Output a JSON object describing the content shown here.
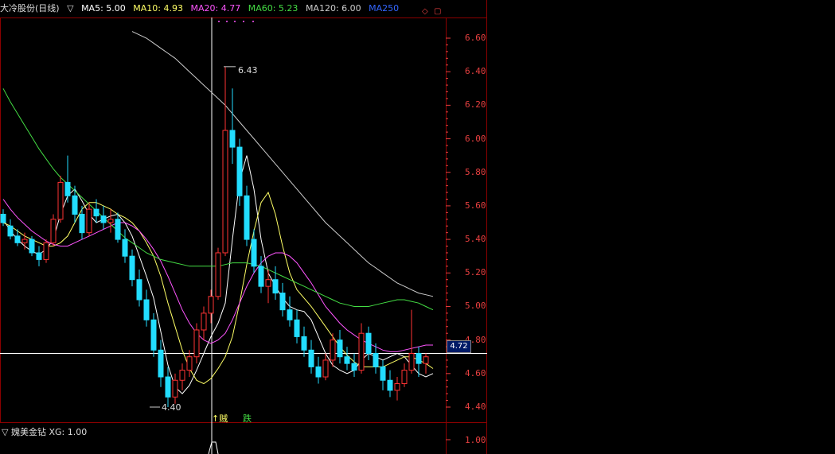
{
  "header": {
    "stock_title": "大冷股份(日线)",
    "arrow": "▽",
    "ma5": "MA5: 5.00",
    "ma10": "MA10: 4.93",
    "ma20": "MA20: 4.77",
    "ma60": "MA60: 5.23",
    "ma120": "MA120: 6.00",
    "ma250": "MA250"
  },
  "colors": {
    "ma5": "#ffffff",
    "ma10": "#ffff66",
    "ma20": "#ff55ff",
    "ma60": "#44dd44",
    "ma120": "#cccccc",
    "ma250": "#3366ff",
    "up": "#ff3333",
    "down": "#22ddff",
    "axis": "#e84040",
    "grid": "#550000"
  },
  "y_axis": [
    "6.60",
    "6.40",
    "6.20",
    "6.00",
    "5.80",
    "5.60",
    "5.40",
    "5.20",
    "5.00",
    "4.80",
    "4.60",
    "4.40"
  ],
  "price_tag": "4.72",
  "annotations": {
    "high": "6.43",
    "low": "4.40"
  },
  "bottom_marks": {
    "left": "↑贼",
    "right": "跌"
  },
  "sub_panel": {
    "title": "▽ 媿美金钻 XG: 1.00",
    "y_value": "1.00"
  },
  "chart_data": {
    "type": "candlestick",
    "ylim": [
      4.3,
      6.75
    ],
    "series": [
      {
        "name": "MA5",
        "values": [
          5.52,
          5.45,
          5.4,
          5.36,
          5.33,
          5.31,
          5.34,
          5.4,
          5.55,
          5.66,
          5.7,
          5.63,
          5.55,
          5.5,
          5.52,
          5.54,
          5.55,
          5.5,
          5.42,
          5.3,
          5.18,
          5.05,
          4.85,
          4.65,
          4.52,
          4.48,
          4.53,
          4.62,
          4.72,
          4.82,
          4.9,
          5.02,
          5.4,
          5.75,
          5.9,
          5.7,
          5.4,
          5.2,
          5.12,
          5.05,
          5.0,
          4.98,
          4.97,
          4.92,
          4.82,
          4.72,
          4.65,
          4.62,
          4.6,
          4.62,
          4.68,
          4.72,
          4.7,
          4.68,
          4.7,
          4.72,
          4.7,
          4.65,
          4.6,
          4.58,
          4.6
        ]
      },
      {
        "name": "MA10",
        "values": [
          5.5,
          5.48,
          5.45,
          5.42,
          5.4,
          5.38,
          5.36,
          5.36,
          5.38,
          5.42,
          5.5,
          5.58,
          5.62,
          5.62,
          5.6,
          5.58,
          5.55,
          5.53,
          5.5,
          5.45,
          5.38,
          5.3,
          5.18,
          5.02,
          4.88,
          4.74,
          4.63,
          4.56,
          4.54,
          4.57,
          4.63,
          4.7,
          4.82,
          5.02,
          5.25,
          5.45,
          5.62,
          5.68,
          5.55,
          5.36,
          5.2,
          5.1,
          5.05,
          5.0,
          4.94,
          4.88,
          4.82,
          4.76,
          4.71,
          4.67,
          4.64,
          4.64,
          4.64,
          4.64,
          4.66,
          4.68,
          4.7,
          4.7,
          4.68,
          4.66,
          4.63
        ]
      },
      {
        "name": "MA20",
        "values": [
          5.64,
          5.58,
          5.53,
          5.49,
          5.45,
          5.42,
          5.39,
          5.37,
          5.36,
          5.36,
          5.38,
          5.4,
          5.42,
          5.44,
          5.46,
          5.48,
          5.5,
          5.5,
          5.48,
          5.45,
          5.4,
          5.34,
          5.27,
          5.18,
          5.08,
          4.98,
          4.9,
          4.84,
          4.8,
          4.78,
          4.8,
          4.84,
          4.92,
          5.02,
          5.12,
          5.2,
          5.26,
          5.3,
          5.32,
          5.32,
          5.3,
          5.26,
          5.2,
          5.14,
          5.07,
          5.0,
          4.95,
          4.9,
          4.86,
          4.83,
          4.8,
          4.78,
          4.76,
          4.74,
          4.73,
          4.73,
          4.74,
          4.75,
          4.76,
          4.77,
          4.77
        ]
      },
      {
        "name": "MA60",
        "values": [
          6.3,
          6.22,
          6.15,
          6.08,
          6.01,
          5.94,
          5.88,
          5.82,
          5.77,
          5.73,
          5.69,
          5.65,
          5.61,
          5.57,
          5.53,
          5.49,
          5.45,
          5.41,
          5.38,
          5.35,
          5.32,
          5.3,
          5.28,
          5.27,
          5.26,
          5.25,
          5.24,
          5.24,
          5.24,
          5.24,
          5.24,
          5.25,
          5.26,
          5.26,
          5.26,
          5.25,
          5.24,
          5.22,
          5.2,
          5.18,
          5.16,
          5.14,
          5.12,
          5.1,
          5.08,
          5.06,
          5.04,
          5.02,
          5.01,
          5.0,
          5.0,
          5.0,
          5.01,
          5.02,
          5.03,
          5.04,
          5.04,
          5.03,
          5.02,
          5.0,
          4.98
        ]
      },
      {
        "name": "MA120",
        "values": [
          null,
          null,
          null,
          null,
          null,
          null,
          null,
          null,
          null,
          null,
          null,
          null,
          null,
          null,
          null,
          null,
          null,
          null,
          6.64,
          6.62,
          6.6,
          6.57,
          6.54,
          6.51,
          6.48,
          6.44,
          6.4,
          6.36,
          6.32,
          6.28,
          6.24,
          6.2,
          6.15,
          6.1,
          6.05,
          6.0,
          5.95,
          5.9,
          5.85,
          5.8,
          5.75,
          5.7,
          5.65,
          5.6,
          5.55,
          5.5,
          5.46,
          5.42,
          5.38,
          5.34,
          5.3,
          5.26,
          5.23,
          5.2,
          5.17,
          5.14,
          5.12,
          5.1,
          5.08,
          5.07,
          5.06
        ]
      }
    ],
    "candles": [
      [
        5.55,
        5.58,
        5.48,
        5.5
      ],
      [
        5.48,
        5.52,
        5.4,
        5.42
      ],
      [
        5.42,
        5.46,
        5.36,
        5.38
      ],
      [
        5.38,
        5.44,
        5.34,
        5.4
      ],
      [
        5.4,
        5.42,
        5.3,
        5.32
      ],
      [
        5.32,
        5.36,
        5.24,
        5.28
      ],
      [
        5.28,
        5.4,
        5.26,
        5.38
      ],
      [
        5.38,
        5.55,
        5.36,
        5.52
      ],
      [
        5.52,
        5.78,
        5.5,
        5.74
      ],
      [
        5.74,
        5.9,
        5.62,
        5.66
      ],
      [
        5.66,
        5.72,
        5.5,
        5.55
      ],
      [
        5.55,
        5.6,
        5.4,
        5.44
      ],
      [
        5.44,
        5.62,
        5.42,
        5.58
      ],
      [
        5.58,
        5.64,
        5.5,
        5.54
      ],
      [
        5.54,
        5.6,
        5.46,
        5.5
      ],
      [
        5.5,
        5.58,
        5.44,
        5.52
      ],
      [
        5.52,
        5.56,
        5.38,
        5.4
      ],
      [
        5.4,
        5.46,
        5.26,
        5.3
      ],
      [
        5.3,
        5.34,
        5.12,
        5.16
      ],
      [
        5.16,
        5.22,
        5.0,
        5.04
      ],
      [
        5.04,
        5.1,
        4.88,
        4.92
      ],
      [
        4.92,
        4.96,
        4.7,
        4.74
      ],
      [
        4.74,
        4.8,
        4.52,
        4.58
      ],
      [
        4.58,
        4.64,
        4.4,
        4.46
      ],
      [
        4.46,
        4.6,
        4.42,
        4.56
      ],
      [
        4.56,
        4.66,
        4.5,
        4.62
      ],
      [
        4.62,
        4.74,
        4.58,
        4.7
      ],
      [
        4.7,
        4.9,
        4.66,
        4.86
      ],
      [
        4.86,
        5.0,
        4.8,
        4.96
      ],
      [
        4.96,
        5.1,
        4.9,
        5.06
      ],
      [
        5.06,
        5.35,
        5.04,
        5.32
      ],
      [
        5.32,
        6.43,
        5.3,
        6.05
      ],
      [
        6.05,
        6.3,
        5.85,
        5.95
      ],
      [
        5.95,
        6.0,
        5.6,
        5.66
      ],
      [
        5.66,
        5.72,
        5.36,
        5.4
      ],
      [
        5.4,
        5.46,
        5.2,
        5.24
      ],
      [
        5.24,
        5.3,
        5.08,
        5.12
      ],
      [
        5.12,
        5.22,
        5.02,
        5.16
      ],
      [
        5.16,
        5.24,
        5.04,
        5.08
      ],
      [
        5.08,
        5.14,
        4.94,
        4.98
      ],
      [
        4.98,
        5.06,
        4.88,
        4.92
      ],
      [
        4.92,
        4.98,
        4.78,
        4.82
      ],
      [
        4.82,
        4.88,
        4.7,
        4.74
      ],
      [
        4.74,
        4.8,
        4.6,
        4.64
      ],
      [
        4.64,
        4.7,
        4.54,
        4.58
      ],
      [
        4.58,
        4.72,
        4.56,
        4.68
      ],
      [
        4.68,
        4.84,
        4.64,
        4.8
      ],
      [
        4.8,
        4.86,
        4.66,
        4.7
      ],
      [
        4.7,
        4.76,
        4.62,
        4.66
      ],
      [
        4.66,
        4.72,
        4.58,
        4.62
      ],
      [
        4.62,
        4.9,
        4.6,
        4.84
      ],
      [
        4.84,
        4.88,
        4.68,
        4.72
      ],
      [
        4.72,
        4.78,
        4.6,
        4.64
      ],
      [
        4.64,
        4.68,
        4.5,
        4.56
      ],
      [
        4.56,
        4.62,
        4.46,
        4.5
      ],
      [
        4.5,
        4.58,
        4.44,
        4.54
      ],
      [
        4.54,
        4.66,
        4.52,
        4.62
      ],
      [
        4.62,
        4.98,
        4.6,
        4.72
      ],
      [
        4.72,
        4.76,
        4.58,
        4.66
      ],
      [
        4.66,
        4.72,
        4.6,
        4.7
      ]
    ]
  }
}
